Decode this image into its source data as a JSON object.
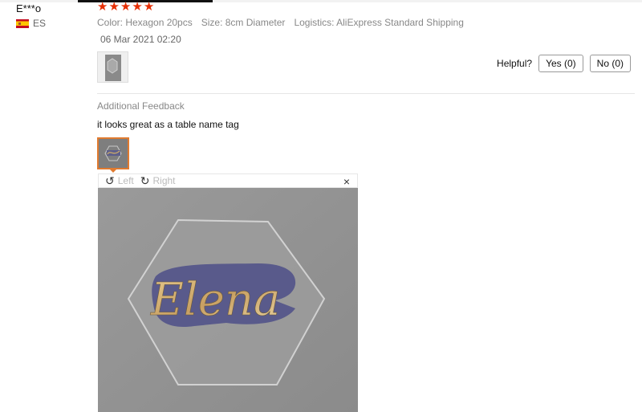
{
  "review": {
    "username": "E***o",
    "country": "ES",
    "stars": [
      "★",
      "★",
      "★",
      "★",
      "★"
    ],
    "meta": {
      "color": "Color: Hexagon 20pcs",
      "size": "Size: 8cm Diameter",
      "logistics": "Logistics: AliExpress Standard Shipping"
    },
    "date": "06 Mar 2021 02:20",
    "helpful": {
      "label": "Helpful?",
      "yes": "Yes (0)",
      "no": "No (0)"
    }
  },
  "additional": {
    "title": "Additional Feedback",
    "text": "it looks great as a table name tag"
  },
  "viewer": {
    "left_label": "Left",
    "right_label": "Right",
    "close_glyph": "×",
    "left_icon": "↺",
    "right_icon": "↻",
    "photo_text": "Elena"
  },
  "colors": {
    "star": "#e62e04",
    "active_thumb": "#e07a2f"
  }
}
